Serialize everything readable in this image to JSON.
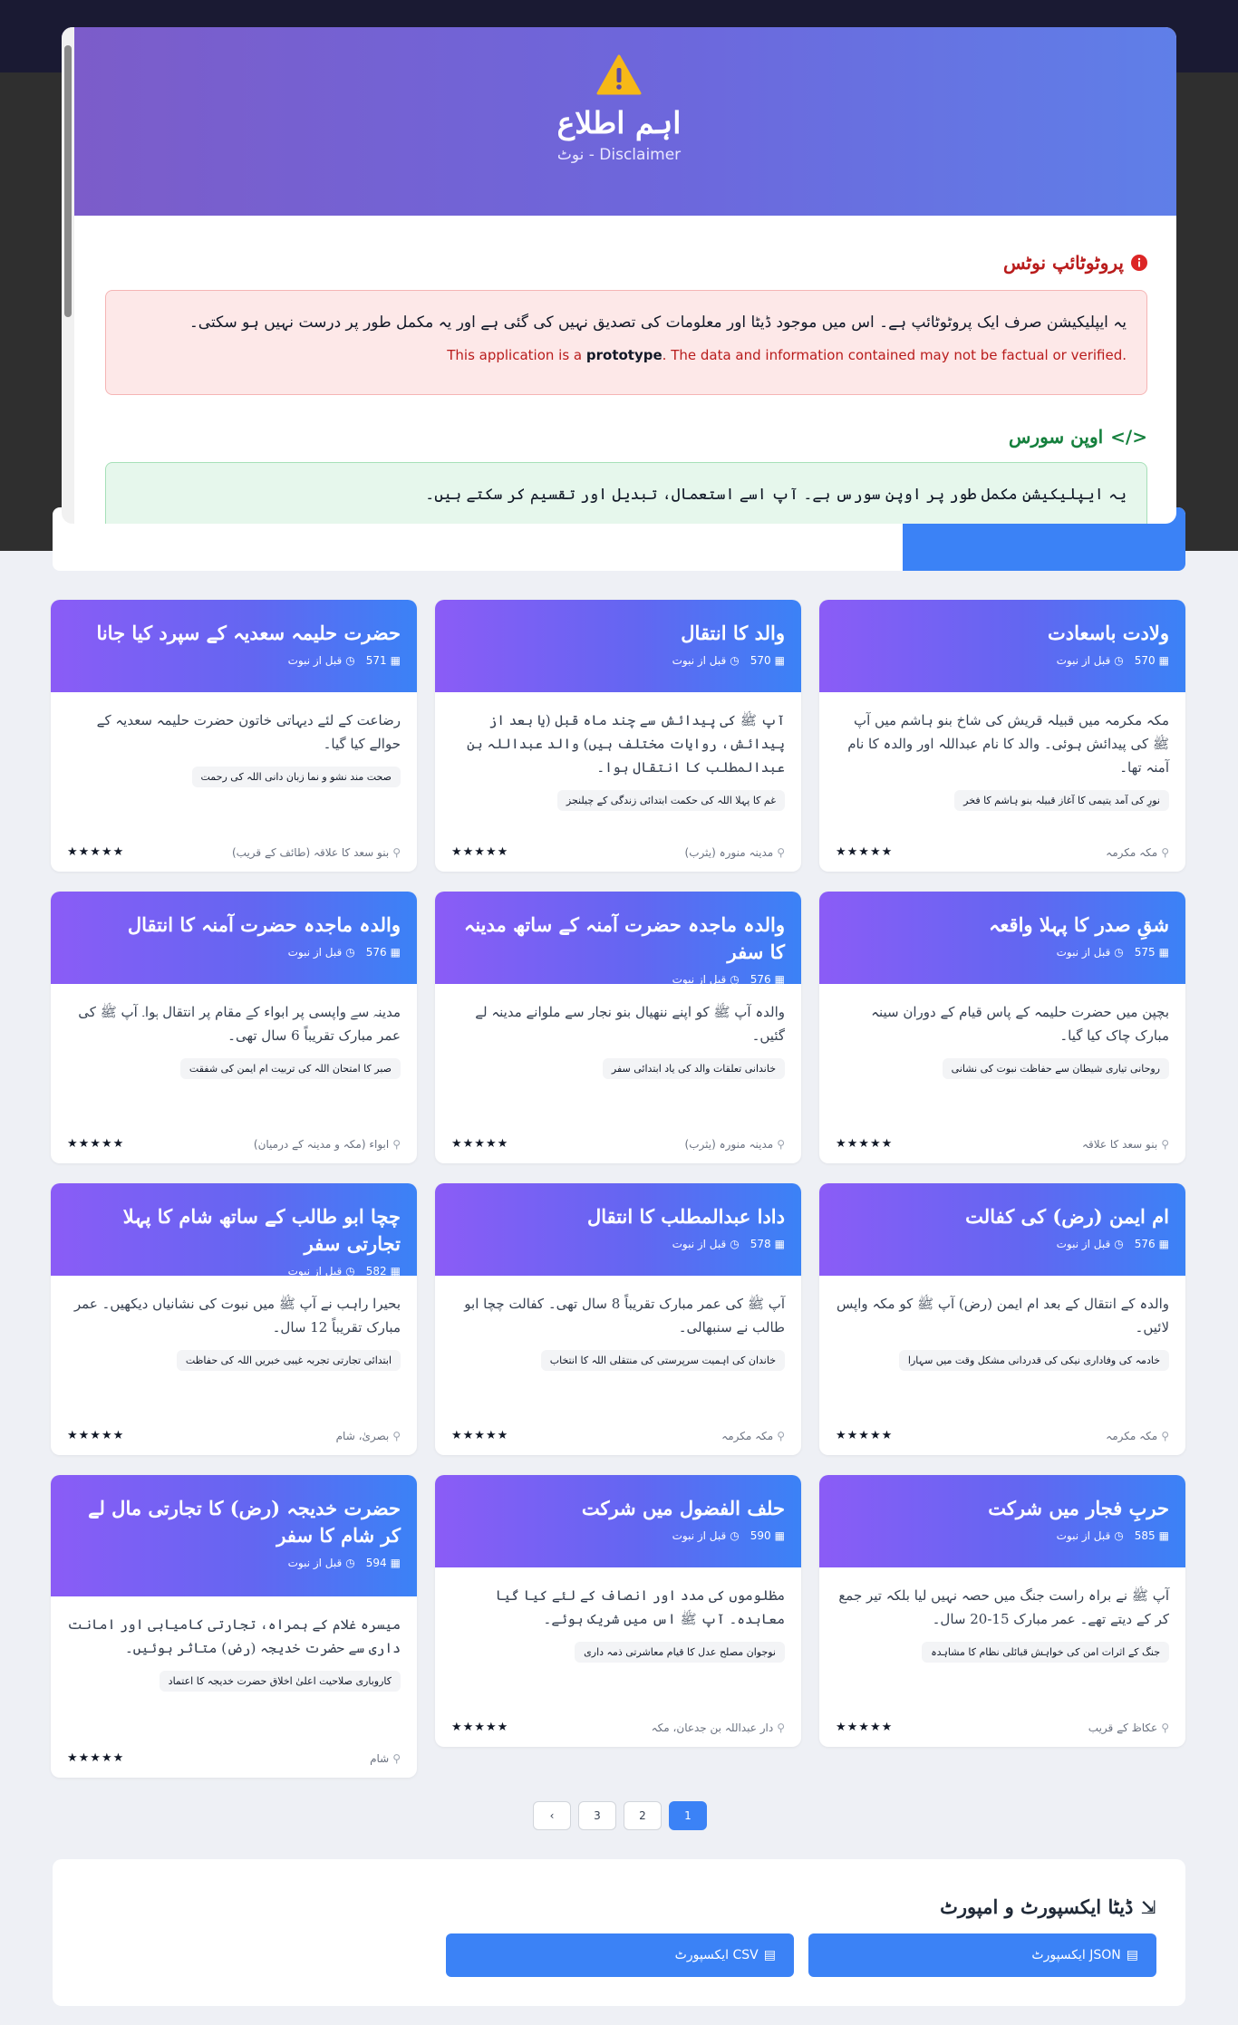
{
  "modal": {
    "title": "اہم اطلاع",
    "subtitle": "Disclaimer - نوٹ",
    "prototype": {
      "title": "پروٹوٹائپ نوٹس",
      "text_ur": "یہ ایپلیکیشن صرف ایک پروٹوٹائپ ہے۔ اس میں موجود ڈیٹا اور معلومات کی تصدیق نہیں کی گئی ہے اور یہ مکمل طور پر درست نہیں ہو سکتی۔",
      "text_en_1": "This application is a ",
      "text_en_bold": "prototype",
      "text_en_2": ". The data and information contained may not be factual or verified."
    },
    "opensource": {
      "title": "اوپن سورس",
      "text_ur": "یہ ایپلیکیشن مکمل طور پر اوپن سورس ہے۔ آپ اسے استعمال، تبدیل اور تقسیم کر سکتے ہیں۔"
    }
  },
  "cards": [
    {
      "title": "ولادت باسعادت",
      "year": "570",
      "era": "قبل از نبوت",
      "desc": "مکہ مکرمہ میں قبیلہ قریش کی شاخ بنو ہاشم میں آپ ﷺ کی پیدائش ہوئی۔ والد کا نام عبداللہ اور والدہ کا نام آمنہ تھا۔",
      "tag": "نورِ کی آمد یتیمی کا آغاز قبیلہ بنو ہاشم کا فخر",
      "place": "مکہ مکرمہ",
      "stars": "★★★★★"
    },
    {
      "title": "والد کا انتقال",
      "year": "570",
      "era": "قبل از نبوت",
      "desc": "آپ ﷺ کی پیدائش سے چند ماہ قبل (یا بعد از پیدائش، روایات مختلف ہیں) والد عبداللہ بن عبدالمطلب کا انتقال ہوا۔",
      "tag": "غم کا پہلا اللہ کی حکمت ابتدائی زندگی کے چیلنجز",
      "place": "مدینہ منورہ (یثرب)",
      "stars": "★★★★★"
    },
    {
      "title": "حضرت حلیمہ سعدیہ کے سپرد کیا جانا",
      "year": "571",
      "era": "قبل از نبوت",
      "desc": "رضاعت کے لئے دیہاتی خاتون حضرت حلیمہ سعدیہ کے حوالے کیا گیا۔",
      "tag": "صحت مند نشو و نما زبان دانی اللہ کی رحمت",
      "place": "بنو سعد کا علاقہ (طائف کے قریب)",
      "stars": "★★★★★"
    },
    {
      "title": "شقِ صدر کا پہلا واقعہ",
      "year": "575",
      "era": "قبل از نبوت",
      "desc": "بچپن میں حضرت حلیمہ کے پاس قیام کے دوران سینہ مبارک چاک کیا گیا۔",
      "tag": "روحانی تیاری شیطان سے حفاظت نبوت کی نشانی",
      "place": "بنو سعد کا علاقہ",
      "stars": "★★★★★"
    },
    {
      "title": "والدہ ماجدہ حضرت آمنہ کے ساتھ مدینہ کا سفر",
      "year": "576",
      "era": "قبل از نبوت",
      "desc": "والدہ آپ ﷺ کو اپنے ننھیال بنو نجار سے ملوانے مدینہ لے گئیں۔",
      "tag": "خاندانی تعلقات والد کی یاد ابتدائی سفر",
      "place": "مدینہ منورہ (یثرب)",
      "stars": "★★★★★"
    },
    {
      "title": "والدہ ماجدہ حضرت آمنہ کا انتقال",
      "year": "576",
      "era": "قبل از نبوت",
      "desc": "مدینہ سے واپسی پر ابواء کے مقام پر انتقال ہوا۔ آپ ﷺ کی عمر مبارک تقریباً 6 سال تھی۔",
      "tag": "صبر کا امتحان اللہ کی تربیت ام ایمن کی شفقت",
      "place": "ابواء (مکہ و مدینہ کے درمیان)",
      "stars": "★★★★★"
    },
    {
      "title": "ام ایمن (رض) کی کفالت",
      "year": "576",
      "era": "قبل از نبوت",
      "desc": "والدہ کے انتقال کے بعد ام ایمن (رض) آپ ﷺ کو مکہ واپس لائیں۔",
      "tag": "خادمہ کی وفاداری نیکی کی قدردانی مشکل وقت میں سہارا",
      "place": "مکہ مکرمہ",
      "stars": "★★★★★"
    },
    {
      "title": "دادا عبدالمطلب کا انتقال",
      "year": "578",
      "era": "قبل از نبوت",
      "desc": "آپ ﷺ کی عمر مبارک تقریباً 8 سال تھی۔ کفالت چچا ابو طالب نے سنبھالی۔",
      "tag": "خاندان کی اہمیت سرپرستی کی منتقلی اللہ کا انتخاب",
      "place": "مکہ مکرمہ",
      "stars": "★★★★★"
    },
    {
      "title": "چچا ابو طالب کے ساتھ شام کا پہلا تجارتی سفر",
      "year": "582",
      "era": "قبل از نبوت",
      "desc": "بحیرا راہب نے آپ ﷺ میں نبوت کی نشانیاں دیکھیں۔ عمر مبارک تقریباً 12 سال۔",
      "tag": "ابتدائی تجارتی تجربہ غیبی خبریں اللہ کی حفاظت",
      "place": "بصریٰ، شام",
      "stars": "★★★★★"
    },
    {
      "title": "حربِ فجار میں شرکت",
      "year": "585",
      "era": "قبل از نبوت",
      "desc": "آپ ﷺ نے براہ راست جنگ میں حصہ نہیں لیا بلکہ تیر جمع کر کے دیتے تھے۔ عمر مبارک 15-20 سال۔",
      "tag": "جنگ کے اثرات امن کی خواہش قبائلی نظام کا مشاہدہ",
      "place": "عکاظ کے قریب",
      "stars": "★★★★★"
    },
    {
      "title": "حلف الفضول میں شرکت",
      "year": "590",
      "era": "قبل از نبوت",
      "desc": "مظلوموں کی مدد اور انصاف کے لئے کیا گیا معاہدہ۔ آپ ﷺ اس میں شریک ہوئے۔",
      "tag": "نوجوان مصلح عدل کا قیام معاشرتی ذمہ داری",
      "place": "دار عبداللہ بن جدعان، مکہ",
      "stars": "★★★★★"
    },
    {
      "title": "حضرت خدیجہ (رض) کا تجارتی مال لے کر شام کا سفر",
      "year": "594",
      "era": "قبل از نبوت",
      "desc": "میسرہ غلام کے ہمراہ، تجارتی کامیابی اور امانت داری سے حضرت خدیجہ (رض) متاثر ہوئیں۔",
      "tag": "کاروباری صلاحیت اعلیٰ اخلاق حضرت خدیجہ کا اعتماد",
      "place": "شام",
      "stars": "★★★★★"
    }
  ],
  "pagination": {
    "pages": [
      "1",
      "2",
      "3"
    ],
    "active": "1",
    "prev": "‹"
  },
  "export": {
    "title": "ڈیٹا ایکسپورٹ و امپورٹ",
    "json_label": "JSON ایکسپورٹ",
    "csv_label": "CSV ایکسپورٹ"
  },
  "colors": {
    "accent": "#3b82f6",
    "header_start": "#8b5cf6",
    "header_end": "#3b82f6"
  }
}
